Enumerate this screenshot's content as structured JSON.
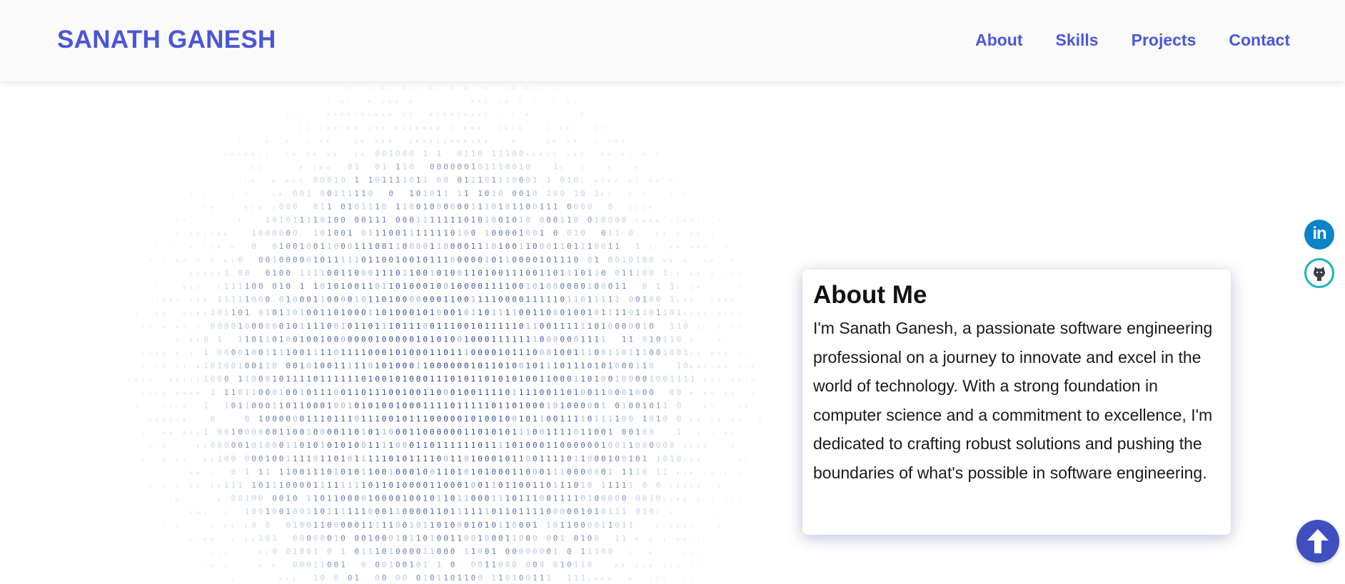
{
  "header": {
    "brand": "SANATH GANESH",
    "nav": [
      {
        "label": "About"
      },
      {
        "label": "Skills"
      },
      {
        "label": "Projects"
      },
      {
        "label": "Contact"
      }
    ]
  },
  "about": {
    "title": "About Me",
    "text": "I'm Sanath Ganesh, a passionate software engineering professional on a journey to innovate and excel in the world of technology. With a strong foundation in computer science and a commitment to excellence, I'm dedicated to crafting robust solutions and pushing the boundaries of what's possible in software engineering."
  },
  "social": {
    "linkedin_icon": "linkedin-icon",
    "github_icon": "github-icon"
  },
  "scroll_top_icon": "arrow-up-icon",
  "colors": {
    "accent": "#4a56d8",
    "linkedin": "#0a84c8",
    "github_ring": "#17b3c1",
    "binary_dark": "#1f3f86",
    "binary_light": "#9bb4d6"
  }
}
